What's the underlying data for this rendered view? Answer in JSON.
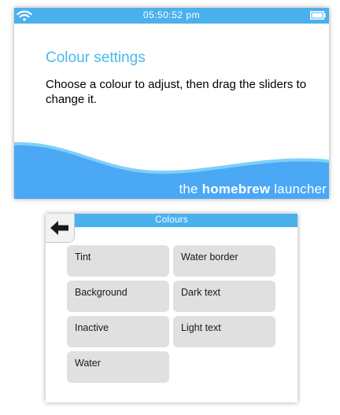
{
  "status_bar": {
    "time": "05:50:52 pm",
    "wifi_icon": "wifi-icon",
    "battery_icon": "battery-icon"
  },
  "top_screen": {
    "title": "Colour settings",
    "description": "Choose a colour to adjust, then drag the sliders to change it.",
    "branding": {
      "prefix": "the ",
      "bold": "homebrew",
      "suffix": " launcher"
    }
  },
  "bottom_screen": {
    "title": "Colours",
    "back_icon": "back-arrow-icon",
    "options": [
      {
        "id": "tint",
        "label": "Tint"
      },
      {
        "id": "water-border",
        "label": "Water border"
      },
      {
        "id": "background",
        "label": "Background"
      },
      {
        "id": "dark-text",
        "label": "Dark text"
      },
      {
        "id": "inactive",
        "label": "Inactive"
      },
      {
        "id": "light-text",
        "label": "Light text"
      },
      {
        "id": "water",
        "label": "Water"
      }
    ]
  },
  "colors": {
    "accent": "#4ab0ee",
    "title_text": "#4ab8ef",
    "water_light": "#7fd0f7",
    "water": "#4aa8f5",
    "button": "#e0e0e0"
  }
}
